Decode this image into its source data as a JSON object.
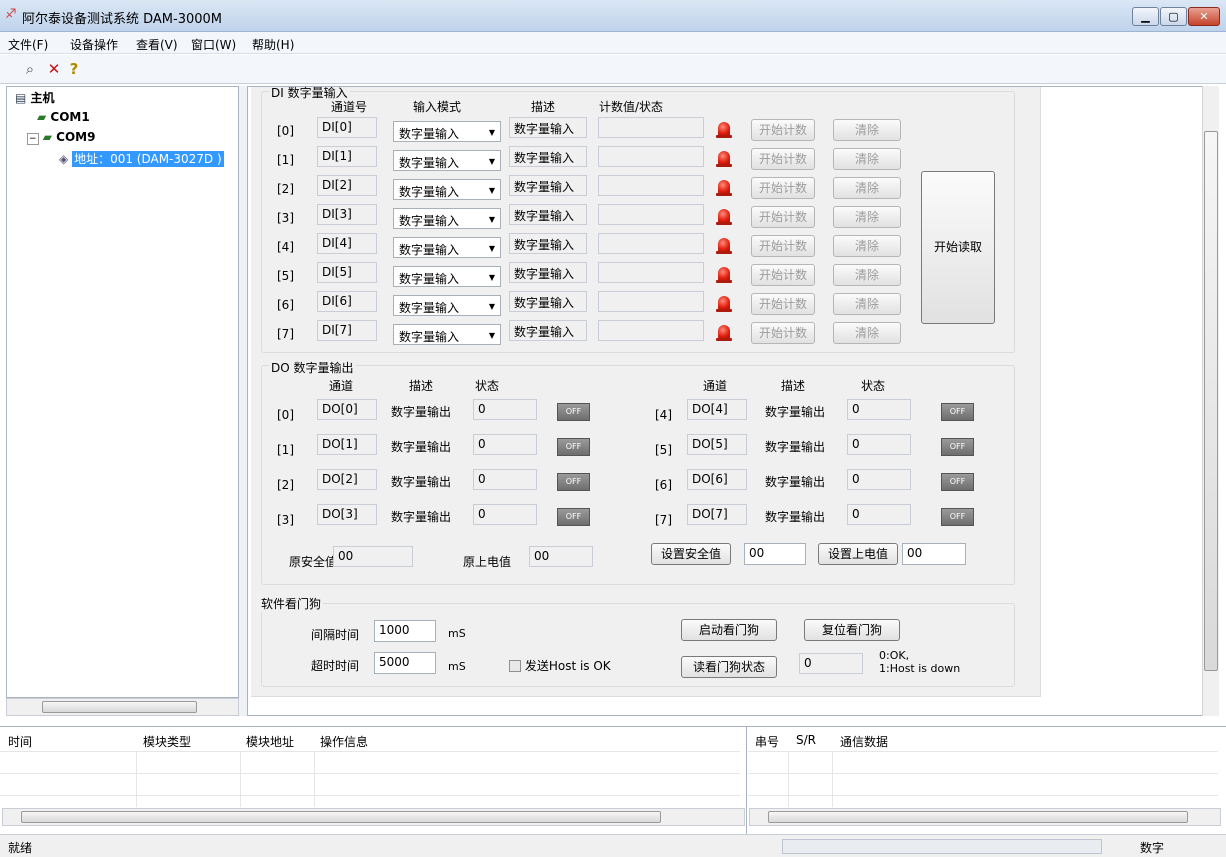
{
  "window": {
    "title": "阿尔泰设备测试系统 DAM-3000M",
    "icon": "app-icon"
  },
  "menu": [
    "文件(F)",
    "设备操作",
    "查看(V)",
    "窗口(W)",
    "帮助(H)"
  ],
  "toolbar": {
    "icons": [
      "search-icon",
      "delete-icon",
      "help-icon"
    ]
  },
  "tree": {
    "root": "主机",
    "com1": "COM1",
    "com9": "COM9",
    "device": "地址：001 (DAM-3027D )"
  },
  "di": {
    "title": "DI 数字量输入",
    "headers": [
      "通道号",
      "输入模式",
      "描述",
      "计数值/状态"
    ],
    "rows": [
      {
        "idx": "[0]",
        "ch": "DI[0]",
        "mode": "数字量输入",
        "desc": "数字量输入",
        "count": ""
      },
      {
        "idx": "[1]",
        "ch": "DI[1]",
        "mode": "数字量输入",
        "desc": "数字量输入",
        "count": ""
      },
      {
        "idx": "[2]",
        "ch": "DI[2]",
        "mode": "数字量输入",
        "desc": "数字量输入",
        "count": ""
      },
      {
        "idx": "[3]",
        "ch": "DI[3]",
        "mode": "数字量输入",
        "desc": "数字量输入",
        "count": ""
      },
      {
        "idx": "[4]",
        "ch": "DI[4]",
        "mode": "数字量输入",
        "desc": "数字量输入",
        "count": ""
      },
      {
        "idx": "[5]",
        "ch": "DI[5]",
        "mode": "数字量输入",
        "desc": "数字量输入",
        "count": ""
      },
      {
        "idx": "[6]",
        "ch": "DI[6]",
        "mode": "数字量输入",
        "desc": "数字量输入",
        "count": ""
      },
      {
        "idx": "[7]",
        "ch": "DI[7]",
        "mode": "数字量输入",
        "desc": "数字量输入",
        "count": ""
      }
    ],
    "start_count_label": "开始计数",
    "clear_label": "清除",
    "start_read_label": "开始读取"
  },
  "do": {
    "title": "DO 数字量输出",
    "headers": [
      "通道",
      "描述",
      "状态"
    ],
    "left": [
      {
        "idx": "[0]",
        "ch": "DO[0]",
        "desc": "数字量输出",
        "state": "0",
        "toggle": "OFF"
      },
      {
        "idx": "[1]",
        "ch": "DO[1]",
        "desc": "数字量输出",
        "state": "0",
        "toggle": "OFF"
      },
      {
        "idx": "[2]",
        "ch": "DO[2]",
        "desc": "数字量输出",
        "state": "0",
        "toggle": "OFF"
      },
      {
        "idx": "[3]",
        "ch": "DO[3]",
        "desc": "数字量输出",
        "state": "0",
        "toggle": "OFF"
      }
    ],
    "right": [
      {
        "idx": "[4]",
        "ch": "DO[4]",
        "desc": "数字量输出",
        "state": "0",
        "toggle": "OFF"
      },
      {
        "idx": "[5]",
        "ch": "DO[5]",
        "desc": "数字量输出",
        "state": "0",
        "toggle": "OFF"
      },
      {
        "idx": "[6]",
        "ch": "DO[6]",
        "desc": "数字量输出",
        "state": "0",
        "toggle": "OFF"
      },
      {
        "idx": "[7]",
        "ch": "DO[7]",
        "desc": "数字量输出",
        "state": "0",
        "toggle": "OFF"
      }
    ],
    "orig_safe_label": "原安全值",
    "orig_safe_value": "00",
    "orig_power_label": "原上电值",
    "orig_power_value": "00",
    "set_safe_label": "设置安全值",
    "set_safe_value": "00",
    "set_power_label": "设置上电值",
    "set_power_value": "00"
  },
  "watchdog": {
    "title": "软件看门狗",
    "interval_label": "间隔时间",
    "interval_value": "1000",
    "interval_unit": "mS",
    "timeout_label": "超时时间",
    "timeout_value": "5000",
    "timeout_unit": "mS",
    "host_ok_label": "发送Host is OK",
    "start_label": "启动看门狗",
    "reset_label": "复位看门狗",
    "read_label": "读看门狗状态",
    "state_value": "0",
    "legend_line1": "0:OK,",
    "legend_line2": "1:Host is down"
  },
  "log": {
    "headers": [
      "时间",
      "模块类型",
      "模块地址",
      "操作信息"
    ],
    "comm_headers": [
      "串号",
      "S/R",
      "通信数据"
    ]
  },
  "status": {
    "text": "就绪",
    "mode": "数字"
  }
}
